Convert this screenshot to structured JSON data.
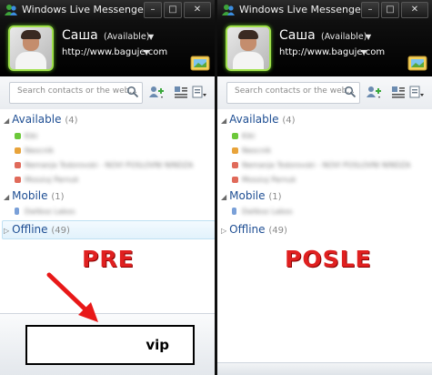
{
  "left": {
    "window_title": "Windows Live Messenger",
    "user_name": "Саша",
    "status": "(Available)",
    "personal_url": "http://www.baguje.com",
    "search_placeholder": "Search contacts or the web...",
    "groups": [
      {
        "name": "Available",
        "count": "(4)"
      },
      {
        "name": "Mobile",
        "count": "(1)"
      },
      {
        "name": "Offline",
        "count": "(49)"
      }
    ],
    "contacts_available": [
      {
        "name": "Kiki",
        "status_color": "#6cc83a"
      },
      {
        "name": "Neocnik",
        "status_color": "#e8a33a"
      },
      {
        "name": "Nemanja Todorovski - NOVI POSLOVNI NINDZA",
        "status_color": "#e06a5a"
      },
      {
        "name": "Mossiuj Parnuk",
        "status_color": "#e06a5a"
      }
    ],
    "contacts_mobile": [
      {
        "name": "Daliboz Labos",
        "status_color": "#7aa0d8"
      }
    ],
    "label": "PRE",
    "bottom_text": "vip"
  },
  "right": {
    "window_title": "Windows Live Messenger",
    "user_name": "Саша",
    "status": "(Available)",
    "personal_url": "http://www.baguje.com",
    "search_placeholder": "Search contacts or the web...",
    "groups": [
      {
        "name": "Available",
        "count": "(4)"
      },
      {
        "name": "Mobile",
        "count": "(1)"
      },
      {
        "name": "Offline",
        "count": "(49)"
      }
    ],
    "contacts_available": [
      {
        "name": "Kiki",
        "status_color": "#6cc83a"
      },
      {
        "name": "Neocnik",
        "status_color": "#e8a33a"
      },
      {
        "name": "Nemanja Todorovski - NOVI POSLOVNI NINDZA",
        "status_color": "#e06a5a"
      },
      {
        "name": "Mossiuj Parnuk",
        "status_color": "#e06a5a"
      }
    ],
    "contacts_mobile": [
      {
        "name": "Daliboz Labos",
        "status_color": "#7aa0d8"
      }
    ],
    "label": "POSLE"
  },
  "colors": {
    "stamp": "#e02020",
    "arrow": "#e81818",
    "group_text": "#1e4e93",
    "avatar_border": "#9fe04a"
  }
}
